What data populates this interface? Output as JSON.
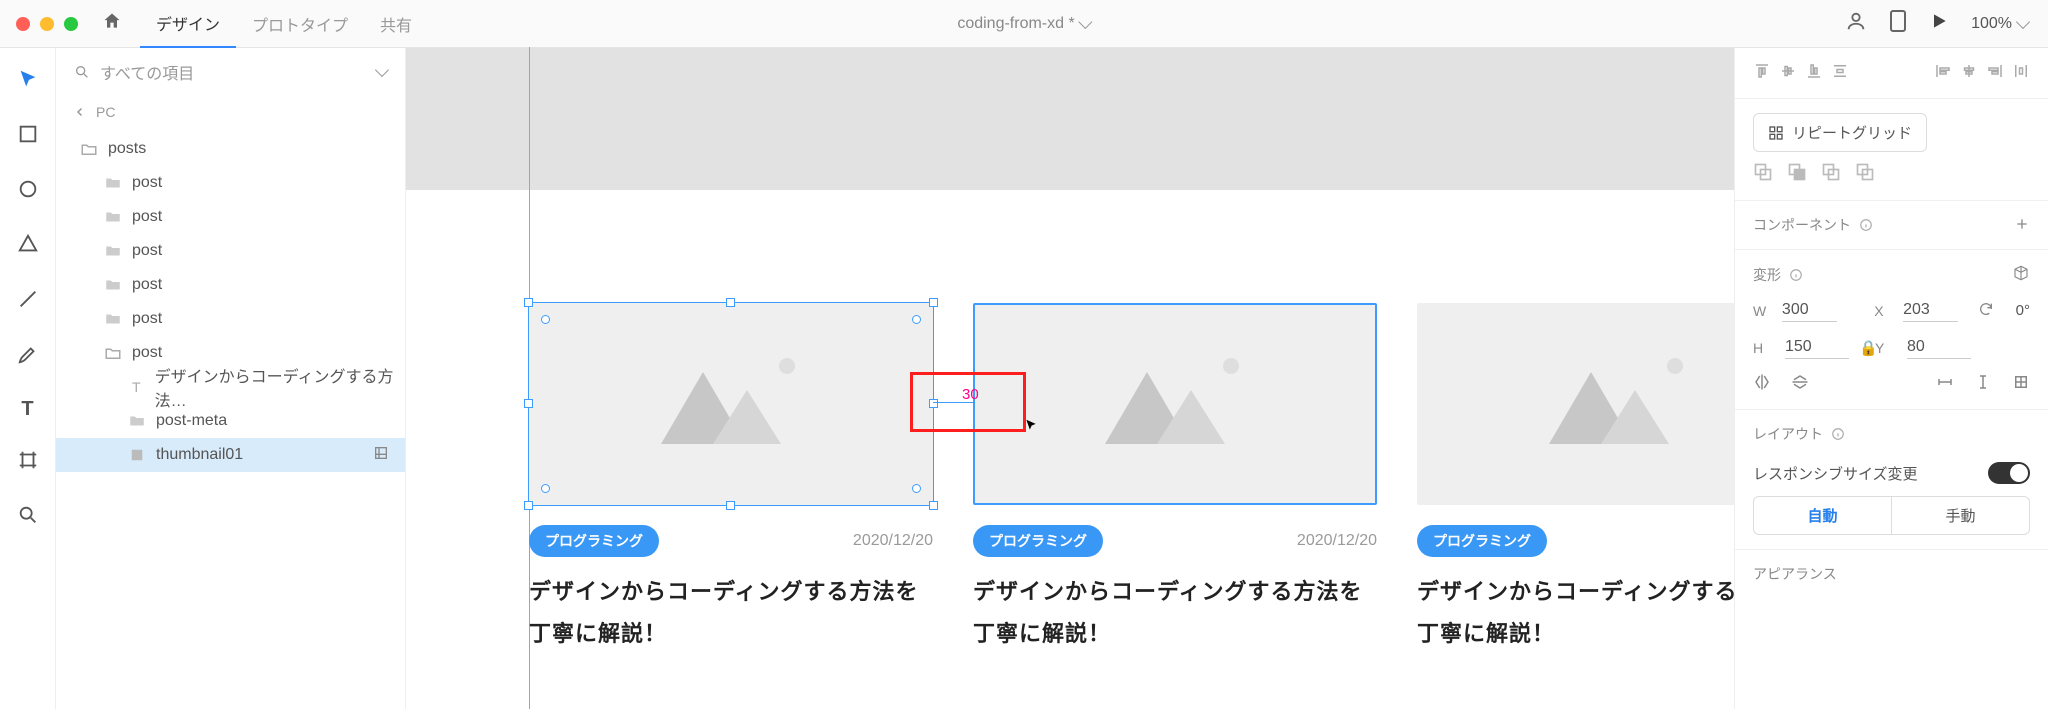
{
  "topbar": {
    "tabs": [
      "デザイン",
      "プロトタイプ",
      "共有"
    ],
    "doc_title": "coding-from-xd *",
    "zoom": "100%"
  },
  "layers": {
    "search_placeholder": "すべての項目",
    "crumb": "PC",
    "root": "posts",
    "posts": [
      "post",
      "post",
      "post",
      "post",
      "post"
    ],
    "open_post": "post",
    "children": {
      "text_layer": "デザインからコーディングする方法…",
      "meta_folder": "post-meta",
      "selected": "thumbnail01"
    }
  },
  "canvas": {
    "category": "プログラミング",
    "date": "2020/12/20",
    "post_title": "デザインからコーディングする方法を丁寧に解説！",
    "spacing_value": "30"
  },
  "right": {
    "repeat_grid": "リピートグリッド",
    "component_label": "コンポーネント",
    "transform_label": "変形",
    "w_label": "W",
    "w_val": "300",
    "h_label": "H",
    "h_val": "150",
    "x_label": "X",
    "x_val": "203",
    "y_label": "Y",
    "y_val": "80",
    "rotation": "0°",
    "layout_label": "レイアウト",
    "responsive_label": "レスポンシブサイズ変更",
    "seg_auto": "自動",
    "seg_manual": "手動",
    "appearance_label": "アピアランス"
  }
}
